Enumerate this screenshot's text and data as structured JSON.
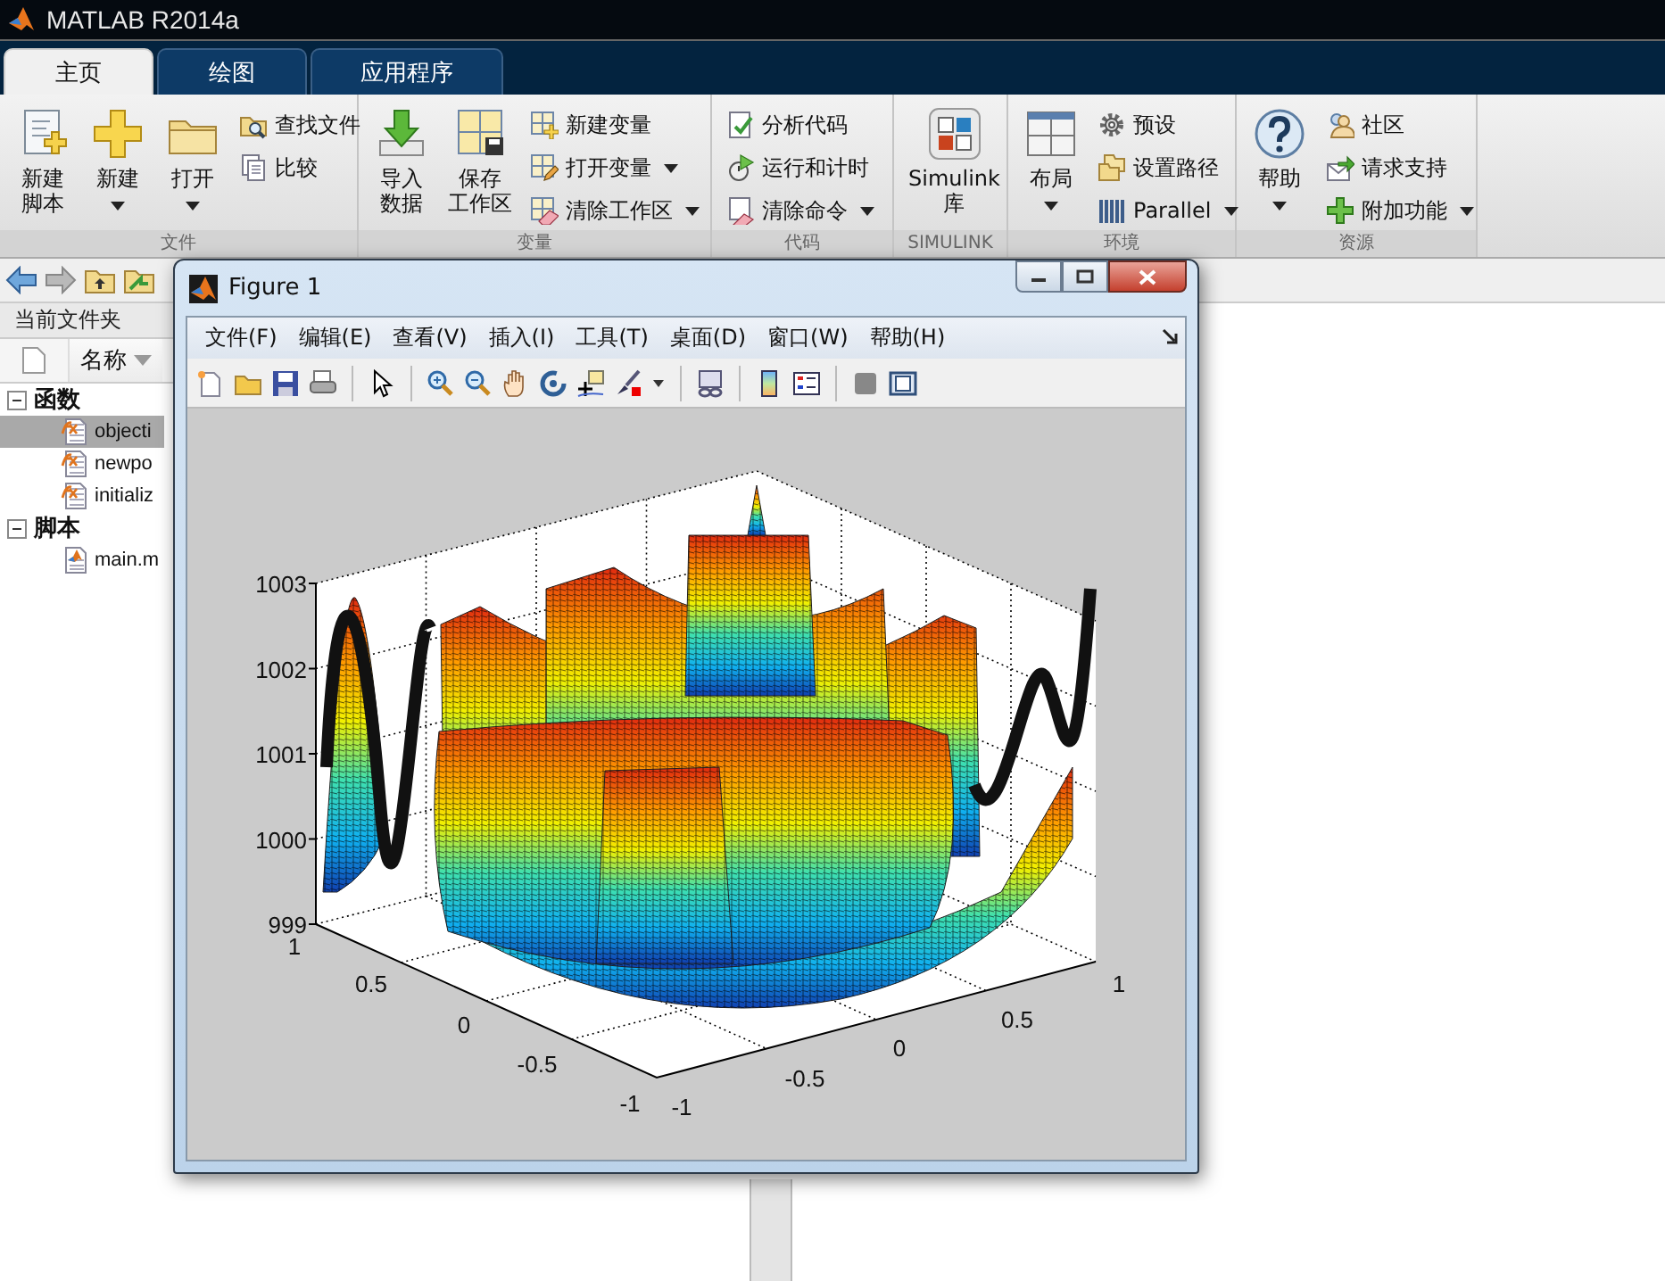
{
  "window": {
    "title": "MATLAB R2014a"
  },
  "tabs": [
    {
      "label": "主页",
      "selected": true
    },
    {
      "label": "绘图",
      "selected": false
    },
    {
      "label": "应用程序",
      "selected": false
    }
  ],
  "ribbon_groups": [
    {
      "title": "文件",
      "items": [
        {
          "kind": "large",
          "lines": [
            "新建",
            "脚本"
          ],
          "dropdown": false
        },
        {
          "kind": "large",
          "lines": [
            "新建"
          ],
          "dropdown": true
        },
        {
          "kind": "large",
          "lines": [
            "打开"
          ],
          "dropdown": true
        },
        {
          "kind": "small",
          "label": "查找文件",
          "dropdown": false
        },
        {
          "kind": "small",
          "label": "比较",
          "dropdown": false
        }
      ]
    },
    {
      "title": "变量",
      "items": [
        {
          "kind": "large",
          "lines": [
            "导入",
            "数据"
          ],
          "dropdown": false
        },
        {
          "kind": "large",
          "lines": [
            "保存",
            "工作区"
          ],
          "dropdown": false
        },
        {
          "kind": "small",
          "label": "新建变量",
          "dropdown": false
        },
        {
          "kind": "small",
          "label": "打开变量",
          "dropdown": true
        },
        {
          "kind": "small",
          "label": "清除工作区",
          "dropdown": true
        }
      ]
    },
    {
      "title": "代码",
      "items": [
        {
          "kind": "small",
          "label": "分析代码",
          "dropdown": false
        },
        {
          "kind": "small",
          "label": "运行和计时",
          "dropdown": false
        },
        {
          "kind": "small",
          "label": "清除命令",
          "dropdown": true
        }
      ]
    },
    {
      "title": "SIMULINK",
      "items": [
        {
          "kind": "large",
          "lines": [
            "Simulink",
            "库"
          ],
          "dropdown": false
        }
      ]
    },
    {
      "title": "环境",
      "items": [
        {
          "kind": "large",
          "lines": [
            "布局"
          ],
          "dropdown": true
        },
        {
          "kind": "small",
          "label": "预设",
          "dropdown": false
        },
        {
          "kind": "small",
          "label": "设置路径",
          "dropdown": false
        },
        {
          "kind": "small",
          "label": "Parallel",
          "dropdown": true
        }
      ]
    },
    {
      "title": "资源",
      "items": [
        {
          "kind": "large",
          "lines": [
            "帮助"
          ],
          "dropdown": true
        },
        {
          "kind": "small",
          "label": "社区",
          "dropdown": false
        },
        {
          "kind": "small",
          "label": "请求支持",
          "dropdown": false
        },
        {
          "kind": "small",
          "label": "附加功能",
          "dropdown": true
        }
      ]
    }
  ],
  "current_folder": {
    "title": "当前文件夹",
    "column": "名称",
    "tree": [
      {
        "label": "函数",
        "expanded": true,
        "children": [
          {
            "label": "objecti",
            "kind": "function",
            "selected": true
          },
          {
            "label": "newpo",
            "kind": "function",
            "selected": false
          },
          {
            "label": "initializ",
            "kind": "function",
            "selected": false
          }
        ]
      },
      {
        "label": "脚本",
        "expanded": true,
        "children": [
          {
            "label": "main.m",
            "kind": "script",
            "selected": false
          }
        ]
      }
    ]
  },
  "figure": {
    "title": "Figure 1",
    "menu": [
      "文件(F)",
      "编辑(E)",
      "查看(V)",
      "插入(I)",
      "工具(T)",
      "桌面(D)",
      "窗口(W)",
      "帮助(H)"
    ],
    "plot": {
      "z_ticks": [
        "1003",
        "1002",
        "1001",
        "1000",
        "999"
      ],
      "left_axis_ticks": [
        "1",
        "0.5",
        "0",
        "-0.5",
        "-1"
      ],
      "right_axis_ticks": [
        "-1",
        "-0.5",
        "0",
        "0.5",
        "1"
      ]
    }
  }
}
